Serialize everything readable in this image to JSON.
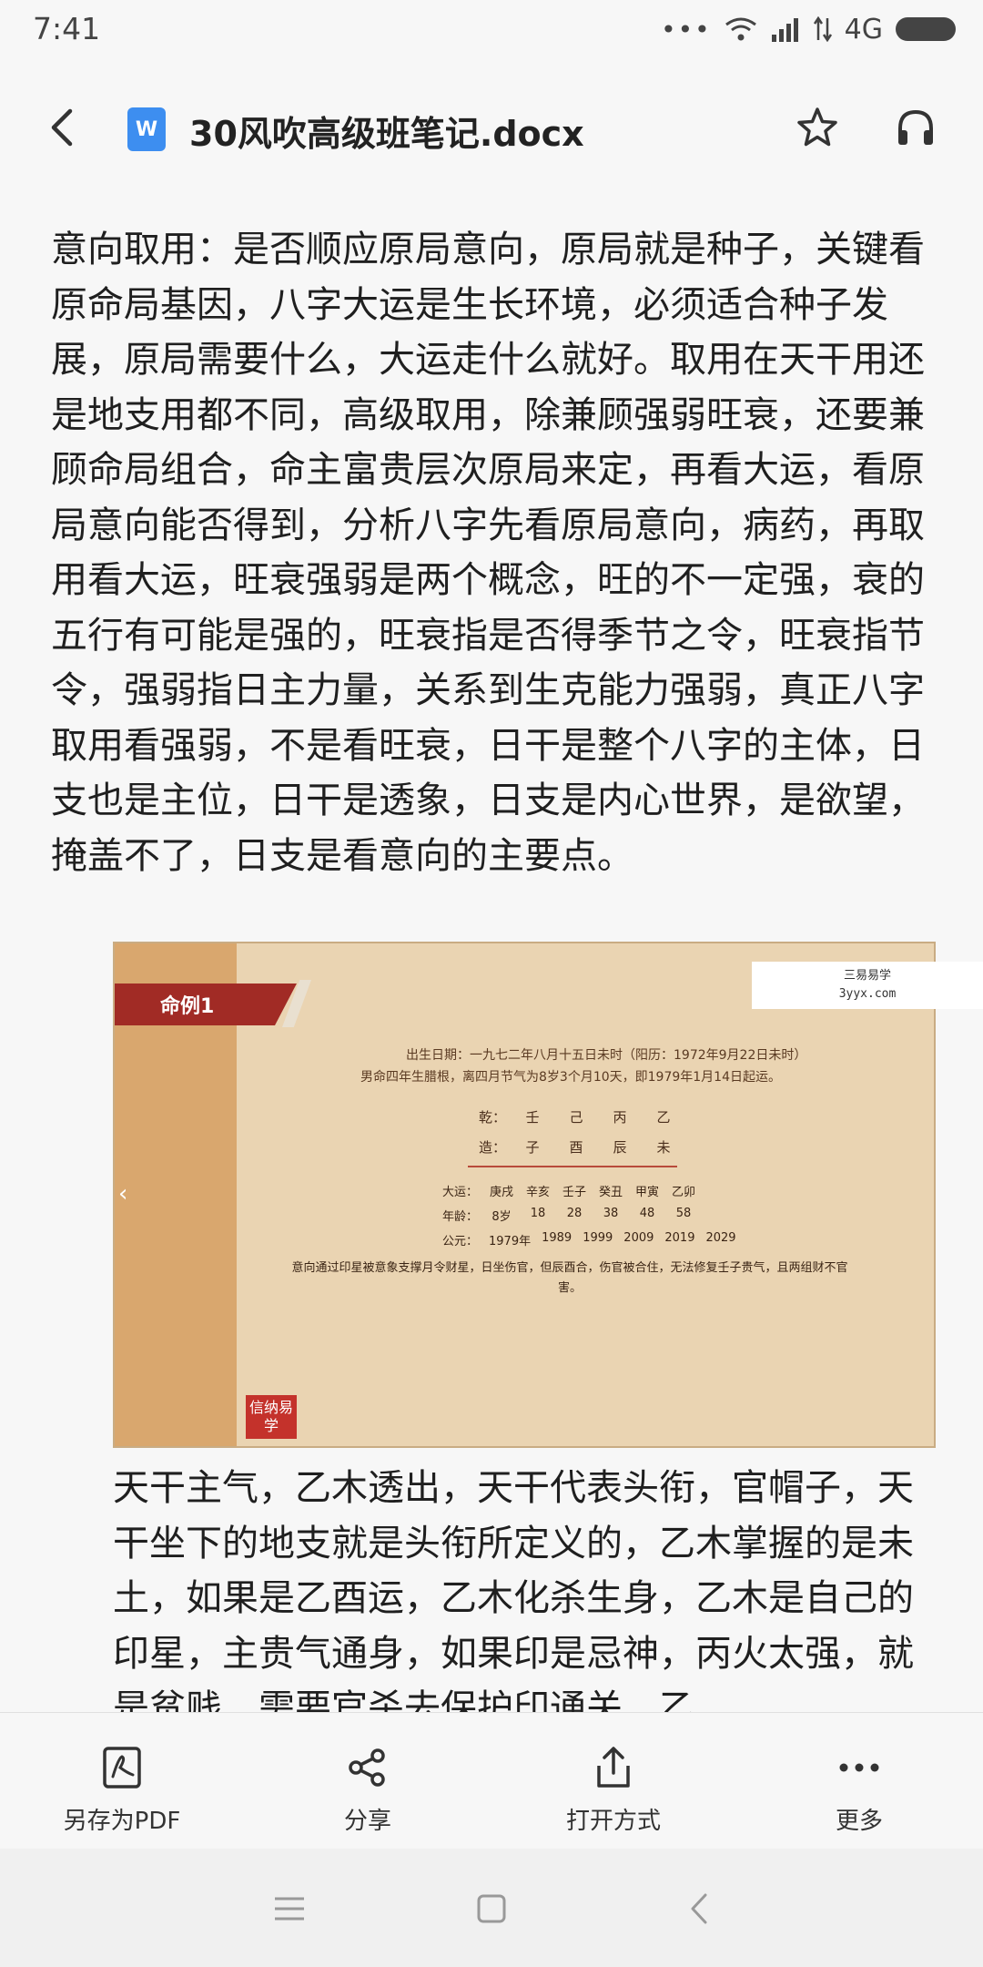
{
  "status_bar": {
    "time": "7:41",
    "dots": "•••",
    "network": "4G"
  },
  "header": {
    "doc_icon_letter": "W",
    "title": "30风吹高级班笔记.docx"
  },
  "document": {
    "paragraph_1": "意向取用：是否顺应原局意向，原局就是种子，关键看原命局基因，八字大运是生长环境，必须适合种子发展，原局需要什么，大运走什么就好。取用在天干用还是地支用都不同，高级取用，除兼顾强弱旺衰，还要兼顾命局组合，命主富贵层次原局来定，再看大运，看原局意向能否得到，分析八字先看原局意向，病药，再取用看大运，旺衰强弱是两个概念，旺的不一定强，衰的五行有可能是强的，旺衰指是否得季节之令，旺衰指节令，强弱指日主力量，关系到生克能力强弱，真正八字取用看强弱，不是看旺衰，日干是整个八字的主体，日支也是主位，日干是透象，日支是内心世界，是欲望，掩盖不了，日支是看意向的主要点。",
    "slide": {
      "banner": "命例1",
      "line_1": "出生日期：一九七二年八月十五日未时（阳历：1972年9月22日未时）",
      "line_2": "男命四年生腊根，离四月节气为8岁3个月10天，即1979年1月14日起运。",
      "stems": [
        "乾：",
        "壬",
        "己",
        "丙",
        "乙"
      ],
      "branches": [
        "造：",
        "子",
        "酉",
        "辰",
        "未"
      ],
      "dayun_labels": [
        "大运：",
        "庚戌",
        "辛亥",
        "壬子",
        "癸丑",
        "甲寅",
        "乙卯"
      ],
      "ages": [
        "年龄：",
        "8岁",
        "18",
        "28",
        "38",
        "48",
        "58"
      ],
      "years": [
        "公元：",
        "1979年",
        "1989",
        "1999",
        "2009",
        "2019",
        "2029"
      ],
      "note": "意向通过印星被意象支撑月令财星，日坐伤官，但辰酉合，伤官被合住，无法修复壬子贵气，且两组财不官害。",
      "logo": "信纳易学"
    },
    "watermark_line_1": "三易易学",
    "watermark_line_2": "3yyx.com",
    "paragraph_2": "天干主气，乙木透出，天干代表头衔，官帽子，天干坐下的地支就是头衔所定义的，乙木掌握的是未土，如果是乙酉运，乙木化杀生身，乙木是自己的印星，主贵气通身，如果印是忌神，丙火太强，就是贫贱，需要官杀去保护印通关，乙"
  },
  "toolbar": {
    "save_pdf": "另存为PDF",
    "share": "分享",
    "open_with": "打开方式",
    "more": "更多"
  },
  "colors": {
    "doc_icon": "#3d8ef0",
    "slide_banner": "#a12b25",
    "slide_bg": "#ead4b2"
  }
}
